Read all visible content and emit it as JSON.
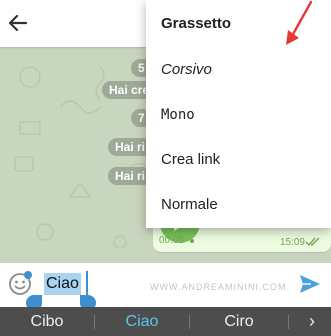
{
  "chat": {
    "date_pills": [
      "5",
      "7"
    ],
    "event_pills": [
      "Hai creato",
      "Hai ri",
      "Hai ri"
    ]
  },
  "voice_message": {
    "duration": "00:05",
    "time": "15:09"
  },
  "format_menu": {
    "items": [
      "Grassetto",
      "Corsivo",
      "Mono",
      "Crea link",
      "Normale"
    ]
  },
  "input": {
    "selected_text": "Ciao",
    "watermark": "WWW.ANDREAMININI.COM"
  },
  "keyboard": {
    "suggestions": [
      "Cibo",
      "Ciao",
      "Ciro"
    ],
    "more_glyph": "›"
  },
  "colors": {
    "accent": "#3f8fd0",
    "play_button": "#78c25a",
    "annotation": "#e53935",
    "suggestion_active": "#5fc6ec"
  },
  "icons": {
    "back": "arrow-left",
    "play": "play-triangle",
    "emoji": "smiley-face",
    "send": "paper-plane",
    "read_status": "double-check"
  }
}
